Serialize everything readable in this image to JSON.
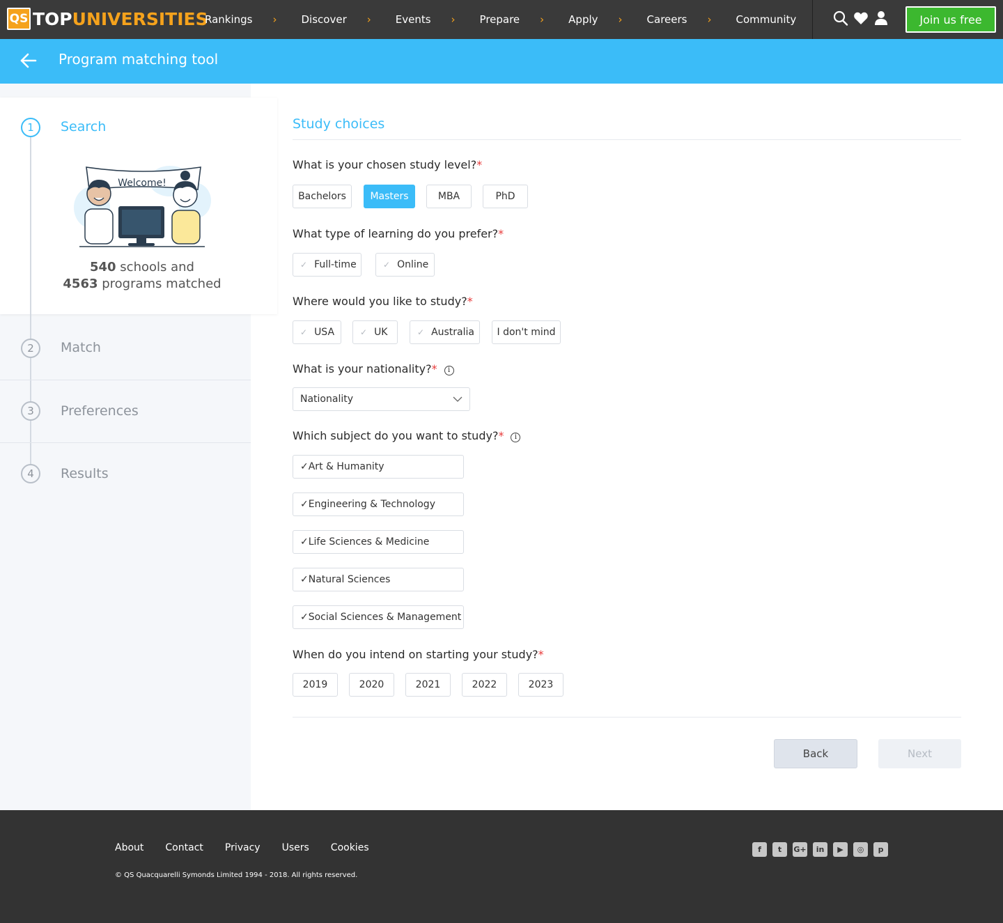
{
  "brand": {
    "qs": "QS",
    "top": "TOP",
    "uni": "UNIVERSITIES"
  },
  "nav": {
    "items": [
      "Rankings",
      "Discover",
      "Events",
      "Prepare",
      "Apply",
      "Careers",
      "Community"
    ],
    "chevron": "›",
    "join_label": "Join us free",
    "icons": [
      "search-icon",
      "heart-icon",
      "user-icon"
    ]
  },
  "header": {
    "title": "Program matching tool"
  },
  "steps": [
    {
      "number": "1",
      "label": "Search"
    },
    {
      "number": "2",
      "label": "Match"
    },
    {
      "number": "3",
      "label": "Preferences"
    },
    {
      "number": "4",
      "label": "Results"
    }
  ],
  "welcome": {
    "banner_text": "Welcome!",
    "schools_count": "540",
    "schools_text": " schools and",
    "programs_count": "4563",
    "programs_text": " programs matched"
  },
  "form": {
    "section_title": "Study choices",
    "study_level": {
      "question": "What is your chosen study level?",
      "options": [
        "Bachelors",
        "Masters",
        "MBA",
        "PhD"
      ],
      "selected": "Masters"
    },
    "learning_type": {
      "question": "What type of learning do you prefer?",
      "options": [
        "Full-time",
        "Online"
      ]
    },
    "location": {
      "question": "Where would you like to study?",
      "options": [
        "USA",
        "UK",
        "Australia",
        "I don't mind"
      ]
    },
    "nationality": {
      "question": "What is your nationality?",
      "placeholder": "Nationality"
    },
    "subject": {
      "question": "Which subject do you want to study?",
      "options": [
        "Art & Humanity",
        "Engineering & Technology",
        "Life Sciences & Medicine",
        "Natural Sciences",
        "Social Sciences & Management"
      ]
    },
    "start_year": {
      "question": "When do you intend on starting your study?",
      "options": [
        "2019",
        "2020",
        "2021",
        "2022",
        "2023"
      ]
    },
    "required_mark": "*",
    "info_mark": "i",
    "back_label": "Back",
    "next_label": "Next"
  },
  "footer": {
    "links": [
      "About",
      "Contact",
      "Privacy",
      "Users",
      "Cookies"
    ],
    "copyright": "© QS Quacquarelli Symonds Limited 1994 - 2018. All rights reserved.",
    "social": [
      "facebook-icon",
      "twitter-icon",
      "google-plus-icon",
      "linkedin-icon",
      "youtube-icon",
      "instagram-icon",
      "pinterest-icon"
    ]
  },
  "colors": {
    "accent": "#3bbcf8",
    "brand_orange": "#f5a21c",
    "join_green": "#3cb82f",
    "nav_bg": "#3a3a3a",
    "required": "#e83a3a"
  }
}
